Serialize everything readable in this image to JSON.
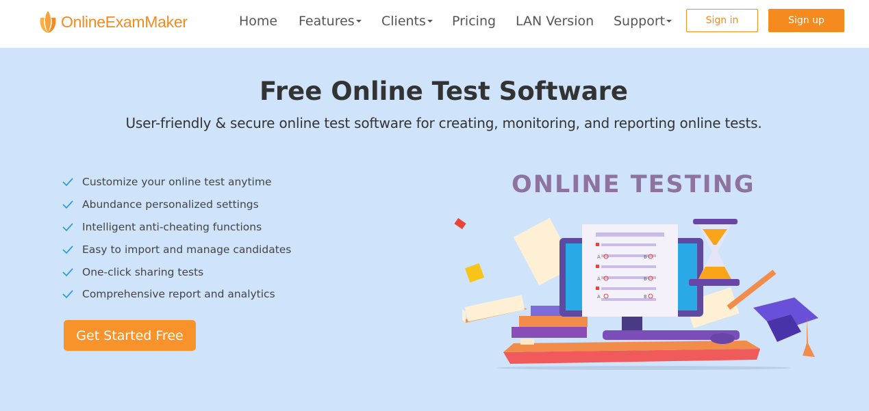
{
  "brand": {
    "name": "OnlineExamMaker",
    "color": "#f58a1f"
  },
  "nav": {
    "items": [
      {
        "label": "Home",
        "dropdown": false
      },
      {
        "label": "Features",
        "dropdown": true
      },
      {
        "label": "Clients",
        "dropdown": true
      },
      {
        "label": "Pricing",
        "dropdown": false
      },
      {
        "label": "LAN Version",
        "dropdown": false
      },
      {
        "label": "Support",
        "dropdown": true
      }
    ],
    "signin_label": "Sign in",
    "signup_label": "Sign up"
  },
  "hero": {
    "title": "Free Online Test Software",
    "subtitle": "User-friendly & secure online test software for creating, monitoring, and reporting online tests.",
    "features": [
      "Customize your online test anytime",
      "Abundance personalized settings",
      "Intelligent anti-cheating functions",
      "Easy to import and manage candidates",
      "One-click sharing tests",
      "Comprehensive report and analytics"
    ],
    "cta_label": "Get Started Free",
    "illustration_title": "ONLINE TESTING",
    "illustration_options": [
      "A",
      "B"
    ]
  },
  "colors": {
    "background": "#cfe4fa",
    "accent": "#f58a1f",
    "check": "#2a9fd8"
  }
}
